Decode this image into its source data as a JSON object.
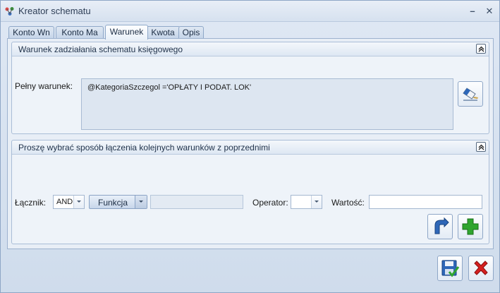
{
  "window": {
    "title": "Kreator schematu",
    "minimize_glyph": "–",
    "close_glyph": "✕"
  },
  "tabs": [
    {
      "label": "Konto Wn",
      "active": false
    },
    {
      "label": "Konto Ma",
      "active": false
    },
    {
      "label": "Warunek",
      "active": true
    },
    {
      "label": "Kwota",
      "active": false
    },
    {
      "label": "Opis",
      "active": false
    }
  ],
  "condition_group": {
    "title": "Warunek zadziałania schematu księgowego",
    "full_condition_label": "Pełny warunek:",
    "full_condition_value": "@KategoriaSzczegol ='OPŁATY I PODAT. LOK'"
  },
  "join_group": {
    "title": "Proszę wybrać sposób łączenia kolejnych warunków z poprzednimi",
    "connector_label": "Łącznik:",
    "connector_value": "AND",
    "function_label": "Funkcja",
    "function_field_value": "",
    "operator_label": "Operator:",
    "operator_value": "",
    "value_label": "Wartość:",
    "value_value": ""
  },
  "icons": {
    "app": "app-icon",
    "collapse": "chevron-double-up-icon",
    "edit": "edit-eraser-icon",
    "undo": "undo-arrow-icon",
    "add": "plus-icon",
    "save": "save-disk-icon",
    "cancel": "cancel-x-icon"
  },
  "colors": {
    "accent_green": "#2fa52f",
    "cancel_red": "#d52020",
    "icon_blue": "#2e67b8"
  }
}
